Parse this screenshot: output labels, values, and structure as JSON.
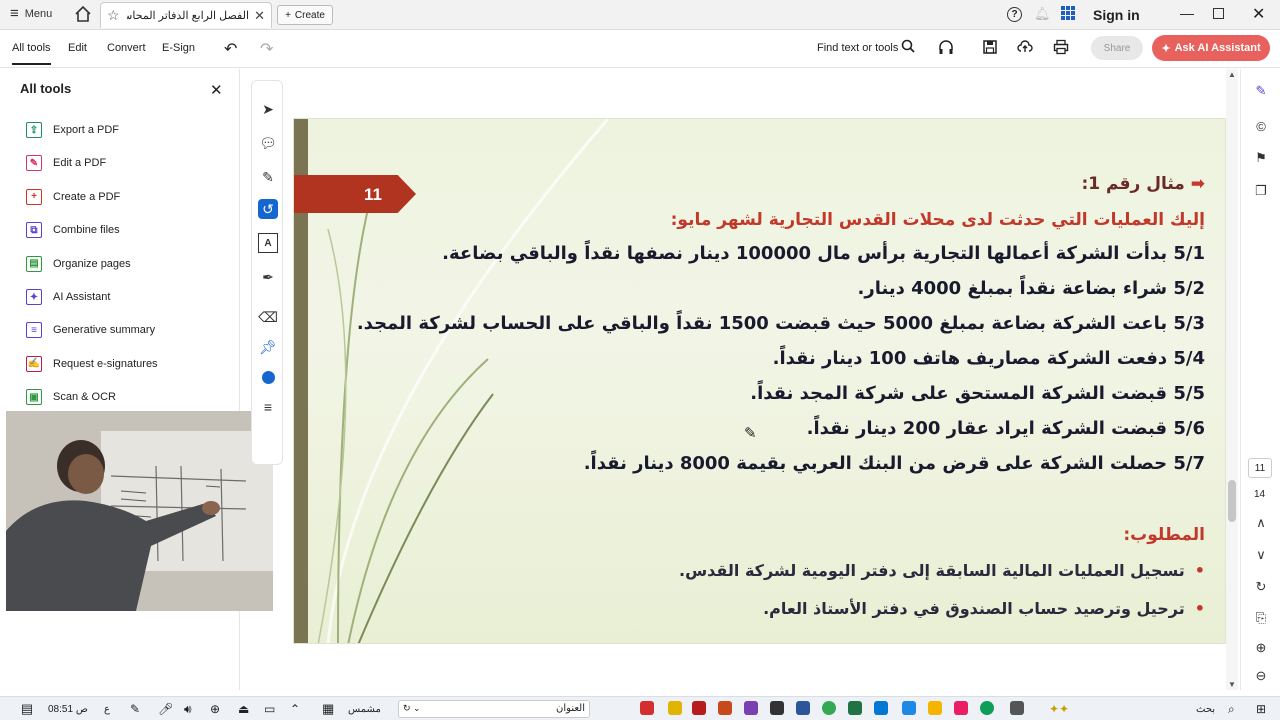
{
  "titlebar": {
    "menu_label": "Menu",
    "tab_title": "الفصل الرابع الدفاتر المحاسبية..",
    "create_label": "Create",
    "sign_in": "Sign in"
  },
  "toolbar": {
    "all_tools": "All tools",
    "edit": "Edit",
    "convert": "Convert",
    "esign": "E-Sign",
    "find_text": "Find text or tools",
    "share": "Share",
    "ask_ai": "Ask AI Assistant"
  },
  "left_panel": {
    "title": "All tools",
    "items": [
      {
        "label": "Export a PDF",
        "icon": "export-pdf-icon",
        "color": "#1f8f6a"
      },
      {
        "label": "Edit a PDF",
        "icon": "edit-pdf-icon",
        "color": "#d6336c"
      },
      {
        "label": "Create a PDF",
        "icon": "create-pdf-icon",
        "color": "#d93025"
      },
      {
        "label": "Combine files",
        "icon": "combine-files-icon",
        "color": "#5c3fd1"
      },
      {
        "label": "Organize pages",
        "icon": "organize-pages-icon",
        "color": "#2e9a3e"
      },
      {
        "label": "AI Assistant",
        "icon": "ai-assistant-icon",
        "color": "#5c3fd1"
      },
      {
        "label": "Generative summary",
        "icon": "generative-summary-icon",
        "color": "#5c3fd1"
      },
      {
        "label": "Request e-signatures",
        "icon": "request-esignatures-icon",
        "color": "#c2185b"
      },
      {
        "label": "Scan & OCR",
        "icon": "scan-ocr-icon",
        "color": "#2e9a3e"
      }
    ]
  },
  "slide": {
    "number": "11",
    "example_title": "مثال رقم 1:",
    "intro": "إليك العمليات التي حدثت لدى محلات القدس التجارية لشهر مايو:",
    "operations": [
      "5/1 بدأت الشركة أعمالها التجارية برأس مال 100000 دينار نصفها نقداً والباقي بضاعة.",
      "5/2 شراء بضاعة نقداً بمبلغ 4000 دينار.",
      "5/3 باعت الشركة بضاعة بمبلغ 5000 حيث قبضت 1500 نقداً والباقي على الحساب لشركة المجد.",
      "5/4 دفعت الشركة مصاريف هاتف 100 دينار نقداً.",
      "5/5 قبضت الشركة المستحق على شركة المجد نقداً.",
      "5/6 قبضت الشركة ايراد عقار 200 دينار نقداً.",
      "5/7 حصلت الشركة على قرض من البنك العربي بقيمة 8000 دينار نقداً."
    ],
    "required_title": "المطلوب:",
    "required_items": [
      "تسجيل العمليات المالية السابقة إلى دفتر اليومية لشركة القدس.",
      "ترحيل وترصيد حساب الصندوق في دفتر الأستاذ العام."
    ],
    "colors": {
      "accent": "#b0341f",
      "intro": "#c0392b",
      "bar": "#7a7452"
    }
  },
  "page_nav": {
    "current": "11",
    "total": "14"
  },
  "taskbar": {
    "time": "08:51 ص",
    "lang": "ع",
    "weather": "مشمس",
    "search_label": "العنوان",
    "search_right": "بحث"
  }
}
